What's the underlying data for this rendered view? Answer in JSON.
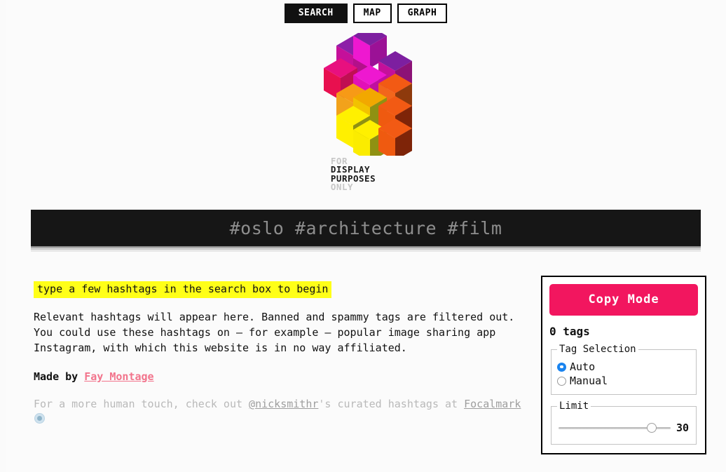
{
  "nav": {
    "tabs": [
      {
        "label": "SEARCH",
        "active": true
      },
      {
        "label": "MAP",
        "active": false
      },
      {
        "label": "GRAPH",
        "active": false
      }
    ]
  },
  "logo": {
    "alt": "isometric-hashtag-logo",
    "line1": "FOR",
    "line2": "DISPLAY",
    "line3": "PURPOSES",
    "line4": "ONLY",
    "colors": {
      "purple_top": "#7d1fa0",
      "magenta_face": "#ee18d0",
      "pink_side": "#e8107f",
      "crimson": "#e8104f",
      "orange": "#f25a14",
      "orange_light": "#f79a16",
      "yellow": "#fff000",
      "olive": "#8f9112",
      "brown": "#8e3a0c",
      "dark_red": "#7e2408"
    }
  },
  "search": {
    "placeholder": "#oslo #architecture #film",
    "value": ""
  },
  "main": {
    "hint": "type a few hashtags in the search box to begin",
    "description": "Relevant hashtags will appear here. Banned and spammy tags are filtered out. You could use these hashtags on — for example — popular image sharing app Instagram, with which this website is in no way affiliated.",
    "made_by_prefix": "Made by ",
    "made_by_link": "Fay Montage",
    "footnote_prefix": "For a more human touch, check out ",
    "footnote_handle": "@nicksmithr",
    "footnote_middle": "'s curated hashtags at ",
    "footnote_link": "Focalmark",
    "lens_icon": "lens-icon"
  },
  "panel": {
    "copy_mode_label": "Copy Mode",
    "copy_mode_color": "#f2165f",
    "tag_count_label": "0 tags",
    "tag_selection": {
      "legend": "Tag Selection",
      "options": [
        {
          "label": "Auto",
          "checked": true
        },
        {
          "label": "Manual",
          "checked": false
        }
      ]
    },
    "limit": {
      "legend": "Limit",
      "value": "30",
      "percent": 83
    }
  },
  "colors": {
    "highlight": "#ffff18",
    "accent_pink": "#f2165f",
    "link_pink": "#f2748c",
    "radio_blue": "#1a84ef",
    "search_bg": "#161616",
    "page_bg": "#fbfbfb"
  }
}
